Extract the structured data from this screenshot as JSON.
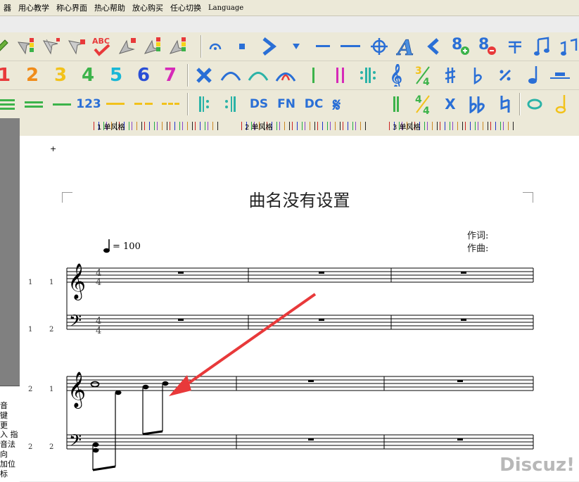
{
  "menu": {
    "items": [
      "器",
      "用心教学",
      "称心界面",
      "热心帮助",
      "放心购买",
      "任心切换",
      "Language"
    ]
  },
  "toolbar1": {
    "numbers": [
      "1",
      "2",
      "3",
      "4",
      "5",
      "6",
      "7"
    ]
  },
  "toolbar2": {
    "numbers": [
      "123"
    ],
    "letters": [
      "DS",
      "FN",
      "DC"
    ],
    "x_label": "X",
    "timesig": "4/4"
  },
  "ruler": {
    "labels": [
      "1 单风格",
      "2 单风格",
      "3 单风格"
    ]
  },
  "left_panel": {
    "chars": [
      "音",
      "键",
      "更",
      "入 指",
      "音法",
      "向",
      "加位",
      "标"
    ]
  },
  "score": {
    "title": "曲名没有设置",
    "lyricist_label": "作词:",
    "composer_label": "作曲:",
    "tempo_text": "= 100",
    "marker": "+",
    "timesig_top": "4",
    "timesig_bottom": "4",
    "staff_numbers": [
      {
        "a": "1",
        "b": "1"
      },
      {
        "a": "1",
        "b": "2"
      },
      {
        "a": "2",
        "b": "1"
      },
      {
        "a": "2",
        "b": "2"
      }
    ]
  },
  "watermark": "Discuz!",
  "colors": {
    "accent_red": "#e8393a",
    "toolbar_bg": "#ece9d8",
    "icon_blue": "#2a6fd6",
    "icon_teal": "#2bb3a7",
    "icon_green": "#3cb34a"
  }
}
